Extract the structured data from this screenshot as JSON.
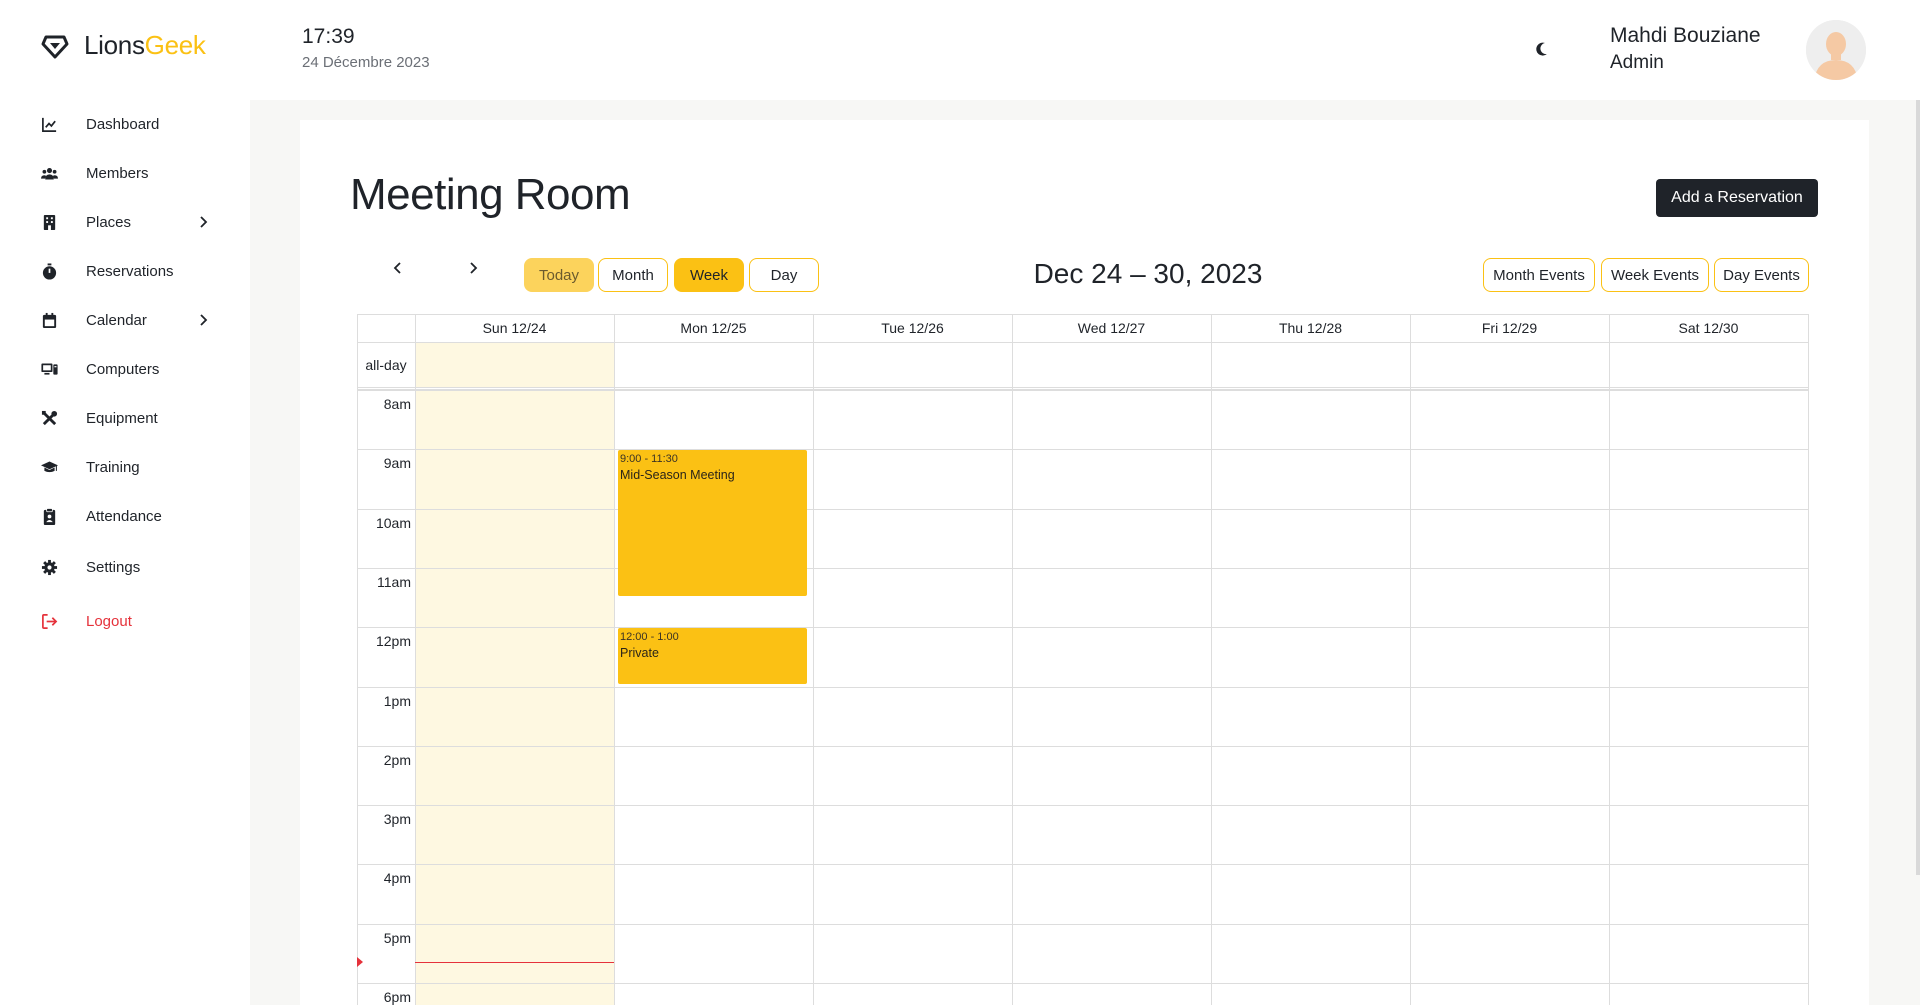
{
  "brand": {
    "part1": "Lions",
    "part2": "Geek",
    "accent": "#fbc114"
  },
  "sidebar": {
    "items": [
      {
        "label": "Dashboard",
        "icon": "chart-line-icon"
      },
      {
        "label": "Members",
        "icon": "users-icon"
      },
      {
        "label": "Places",
        "icon": "building-icon",
        "has_submenu": true
      },
      {
        "label": "Reservations",
        "icon": "stopwatch-icon"
      },
      {
        "label": "Calendar",
        "icon": "calendar-icon",
        "has_submenu": true
      },
      {
        "label": "Computers",
        "icon": "computer-icon"
      },
      {
        "label": "Equipment",
        "icon": "tools-icon"
      },
      {
        "label": "Training",
        "icon": "graduation-cap-icon"
      },
      {
        "label": "Attendance",
        "icon": "clipboard-icon"
      },
      {
        "label": "Settings",
        "icon": "gear-icon"
      },
      {
        "label": "Logout",
        "icon": "logout-icon",
        "color": "#e5323b"
      }
    ]
  },
  "header": {
    "time": "17:39",
    "date": "24 Décembre 2023",
    "theme_icon": "moon-icon",
    "user_name": "Mahdi Bouziane",
    "user_role": "Admin"
  },
  "page": {
    "title": "Meeting Room",
    "add_button": "Add a Reservation"
  },
  "toolbar": {
    "today": "Today",
    "month": "Month",
    "week": "Week",
    "day": "Day",
    "active_view": "Week",
    "range_title": "Dec 24 – 30, 2023",
    "month_events": "Month Events",
    "week_events": "Week Events",
    "day_events": "Day Events"
  },
  "calendar": {
    "days": [
      "Sun 12/24",
      "Mon 12/25",
      "Tue 12/26",
      "Wed 12/27",
      "Thu 12/28",
      "Fri 12/29",
      "Sat 12/30"
    ],
    "today_index": 0,
    "allday_label": "all-day",
    "hours": [
      "8am",
      "9am",
      "10am",
      "11am",
      "12pm",
      "1pm",
      "2pm",
      "3pm",
      "4pm",
      "5pm",
      "6pm"
    ],
    "events": [
      {
        "day": 1,
        "start_hour": 9.0,
        "end_hour": 11.5,
        "time": "9:00 - 11:30",
        "title": "Mid-Season Meeting"
      },
      {
        "day": 1,
        "start_hour": 12.0,
        "end_hour": 13.0,
        "time": "12:00 - 1:00",
        "title": "Private"
      }
    ],
    "now_hour": 17.65,
    "event_color": "#fbc114",
    "today_bg": "#fef8e1",
    "now_color": "#e5323b"
  }
}
